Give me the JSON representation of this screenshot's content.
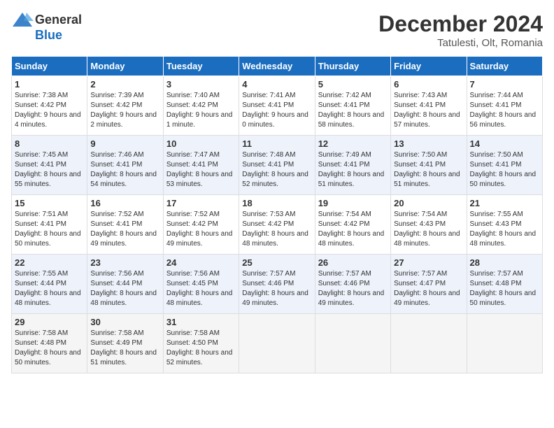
{
  "header": {
    "logo_general": "General",
    "logo_blue": "Blue",
    "month_title": "December 2024",
    "location": "Tatulesti, Olt, Romania"
  },
  "columns": [
    "Sunday",
    "Monday",
    "Tuesday",
    "Wednesday",
    "Thursday",
    "Friday",
    "Saturday"
  ],
  "weeks": [
    [
      {
        "day": "1",
        "sunrise": "7:38 AM",
        "sunset": "4:42 PM",
        "daylight": "9 hours and 4 minutes."
      },
      {
        "day": "2",
        "sunrise": "7:39 AM",
        "sunset": "4:42 PM",
        "daylight": "9 hours and 2 minutes."
      },
      {
        "day": "3",
        "sunrise": "7:40 AM",
        "sunset": "4:42 PM",
        "daylight": "9 hours and 1 minute."
      },
      {
        "day": "4",
        "sunrise": "7:41 AM",
        "sunset": "4:41 PM",
        "daylight": "9 hours and 0 minutes."
      },
      {
        "day": "5",
        "sunrise": "7:42 AM",
        "sunset": "4:41 PM",
        "daylight": "8 hours and 58 minutes."
      },
      {
        "day": "6",
        "sunrise": "7:43 AM",
        "sunset": "4:41 PM",
        "daylight": "8 hours and 57 minutes."
      },
      {
        "day": "7",
        "sunrise": "7:44 AM",
        "sunset": "4:41 PM",
        "daylight": "8 hours and 56 minutes."
      }
    ],
    [
      {
        "day": "8",
        "sunrise": "7:45 AM",
        "sunset": "4:41 PM",
        "daylight": "8 hours and 55 minutes."
      },
      {
        "day": "9",
        "sunrise": "7:46 AM",
        "sunset": "4:41 PM",
        "daylight": "8 hours and 54 minutes."
      },
      {
        "day": "10",
        "sunrise": "7:47 AM",
        "sunset": "4:41 PM",
        "daylight": "8 hours and 53 minutes."
      },
      {
        "day": "11",
        "sunrise": "7:48 AM",
        "sunset": "4:41 PM",
        "daylight": "8 hours and 52 minutes."
      },
      {
        "day": "12",
        "sunrise": "7:49 AM",
        "sunset": "4:41 PM",
        "daylight": "8 hours and 51 minutes."
      },
      {
        "day": "13",
        "sunrise": "7:50 AM",
        "sunset": "4:41 PM",
        "daylight": "8 hours and 51 minutes."
      },
      {
        "day": "14",
        "sunrise": "7:50 AM",
        "sunset": "4:41 PM",
        "daylight": "8 hours and 50 minutes."
      }
    ],
    [
      {
        "day": "15",
        "sunrise": "7:51 AM",
        "sunset": "4:41 PM",
        "daylight": "8 hours and 50 minutes."
      },
      {
        "day": "16",
        "sunrise": "7:52 AM",
        "sunset": "4:41 PM",
        "daylight": "8 hours and 49 minutes."
      },
      {
        "day": "17",
        "sunrise": "7:52 AM",
        "sunset": "4:42 PM",
        "daylight": "8 hours and 49 minutes."
      },
      {
        "day": "18",
        "sunrise": "7:53 AM",
        "sunset": "4:42 PM",
        "daylight": "8 hours and 48 minutes."
      },
      {
        "day": "19",
        "sunrise": "7:54 AM",
        "sunset": "4:42 PM",
        "daylight": "8 hours and 48 minutes."
      },
      {
        "day": "20",
        "sunrise": "7:54 AM",
        "sunset": "4:43 PM",
        "daylight": "8 hours and 48 minutes."
      },
      {
        "day": "21",
        "sunrise": "7:55 AM",
        "sunset": "4:43 PM",
        "daylight": "8 hours and 48 minutes."
      }
    ],
    [
      {
        "day": "22",
        "sunrise": "7:55 AM",
        "sunset": "4:44 PM",
        "daylight": "8 hours and 48 minutes."
      },
      {
        "day": "23",
        "sunrise": "7:56 AM",
        "sunset": "4:44 PM",
        "daylight": "8 hours and 48 minutes."
      },
      {
        "day": "24",
        "sunrise": "7:56 AM",
        "sunset": "4:45 PM",
        "daylight": "8 hours and 48 minutes."
      },
      {
        "day": "25",
        "sunrise": "7:57 AM",
        "sunset": "4:46 PM",
        "daylight": "8 hours and 49 minutes."
      },
      {
        "day": "26",
        "sunrise": "7:57 AM",
        "sunset": "4:46 PM",
        "daylight": "8 hours and 49 minutes."
      },
      {
        "day": "27",
        "sunrise": "7:57 AM",
        "sunset": "4:47 PM",
        "daylight": "8 hours and 49 minutes."
      },
      {
        "day": "28",
        "sunrise": "7:57 AM",
        "sunset": "4:48 PM",
        "daylight": "8 hours and 50 minutes."
      }
    ],
    [
      {
        "day": "29",
        "sunrise": "7:58 AM",
        "sunset": "4:48 PM",
        "daylight": "8 hours and 50 minutes."
      },
      {
        "day": "30",
        "sunrise": "7:58 AM",
        "sunset": "4:49 PM",
        "daylight": "8 hours and 51 minutes."
      },
      {
        "day": "31",
        "sunrise": "7:58 AM",
        "sunset": "4:50 PM",
        "daylight": "8 hours and 52 minutes."
      },
      null,
      null,
      null,
      null
    ]
  ]
}
